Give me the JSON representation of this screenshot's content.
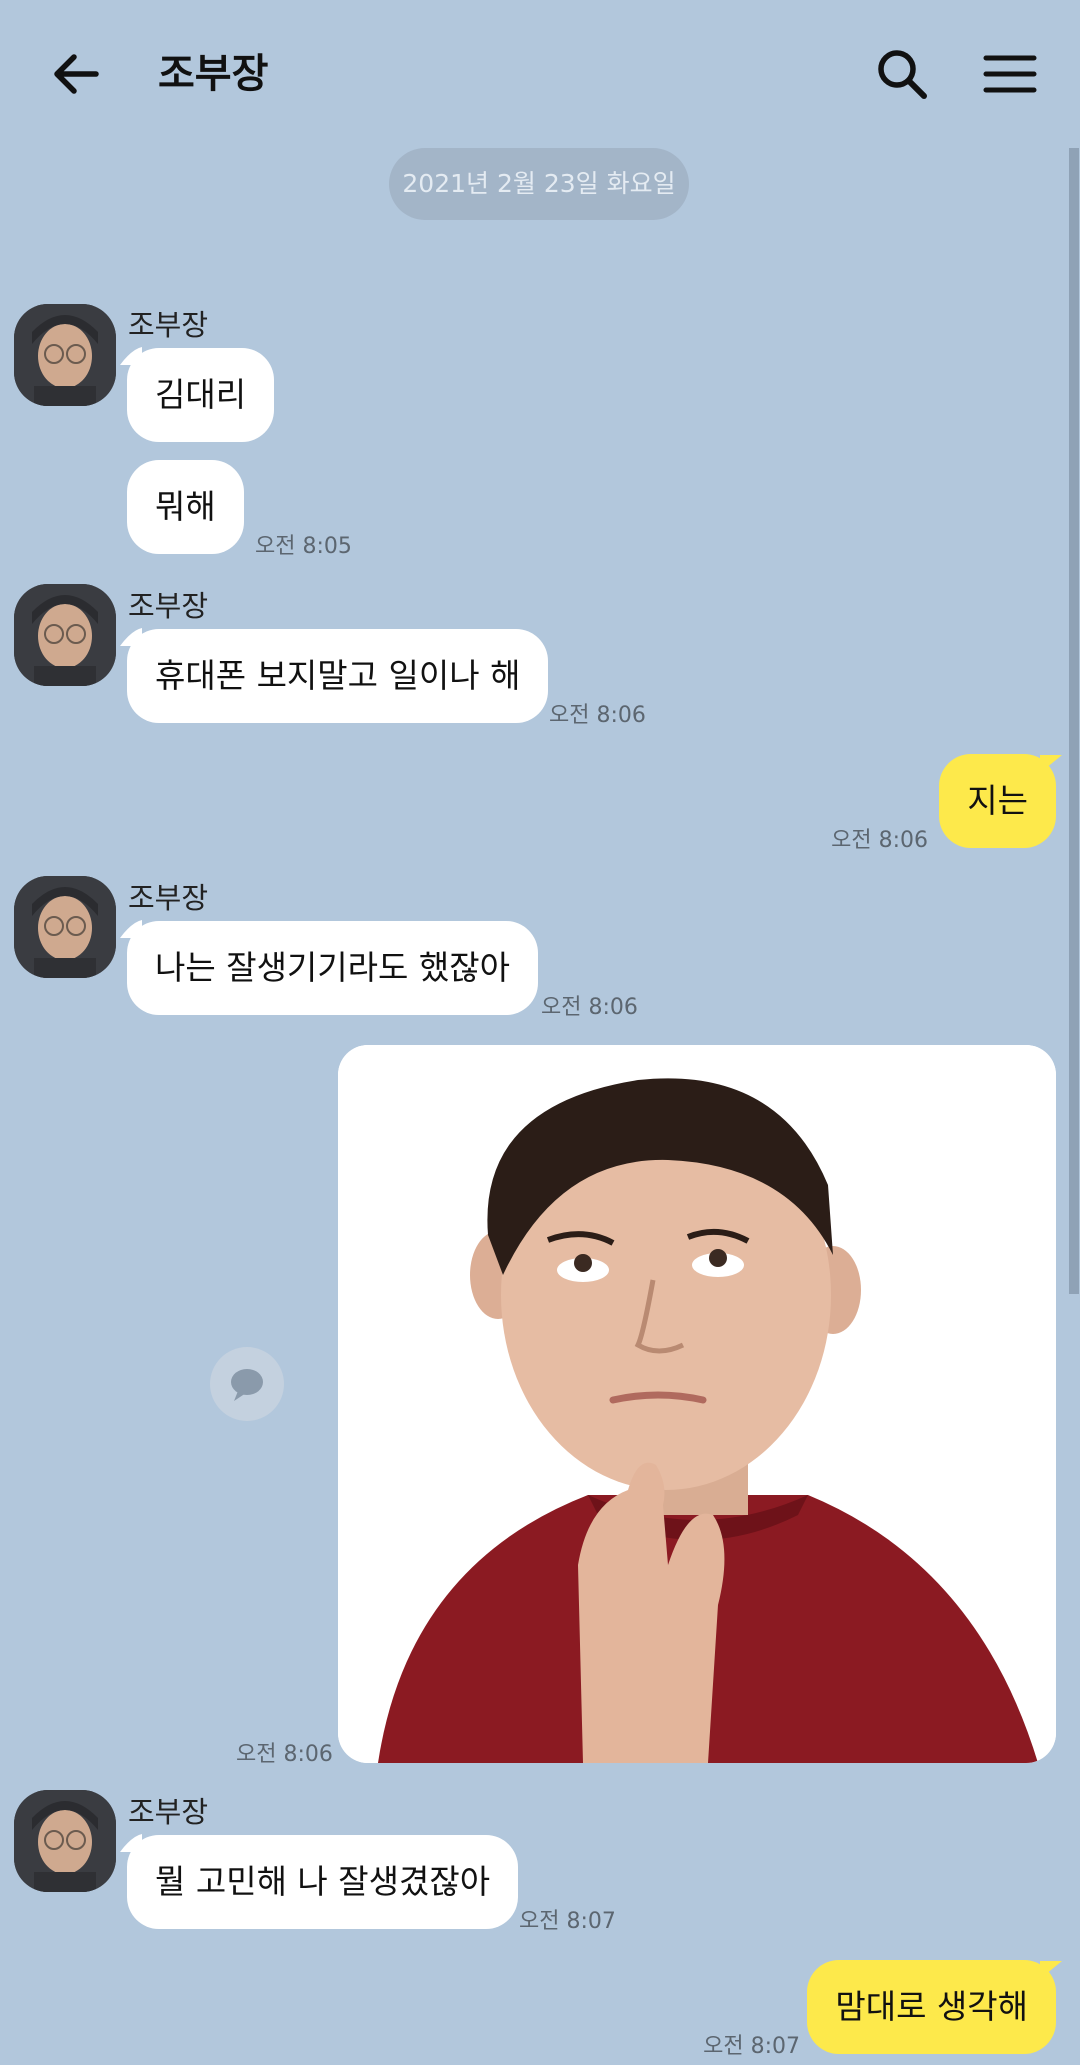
{
  "header": {
    "title": "조부장"
  },
  "date_divider": "2021년 2월 23일 화요일",
  "icons": {
    "back": "arrow-left-icon",
    "search": "search-icon",
    "menu": "hamburger-menu-icon",
    "share": "speech-bubble-icon"
  },
  "colors": {
    "background": "#b2c7dc",
    "incoming_bubble": "#ffffff",
    "outgoing_bubble": "#fde94b"
  },
  "messages": [
    {
      "sender": "조부장",
      "text": "김대리",
      "direction": "incoming"
    },
    {
      "text": "뭐해",
      "time": "오전 8:05",
      "direction": "incoming"
    },
    {
      "sender": "조부장",
      "text": "휴대폰 보지말고 일이나 해",
      "time": "오전 8:06",
      "direction": "incoming"
    },
    {
      "text": "지는",
      "time": "오전 8:06",
      "direction": "outgoing"
    },
    {
      "sender": "조부장",
      "text": "나는 잘생기기라도 했잖아",
      "time": "오전 8:06",
      "direction": "incoming"
    },
    {
      "type": "image",
      "time": "오전 8:06",
      "direction": "outgoing"
    },
    {
      "sender": "조부장",
      "text": "뭘 고민해 나 잘생겼잖아",
      "time": "오전 8:07",
      "direction": "incoming"
    },
    {
      "text": "맘대로 생각해",
      "time": "오전 8:07",
      "direction": "outgoing"
    }
  ]
}
